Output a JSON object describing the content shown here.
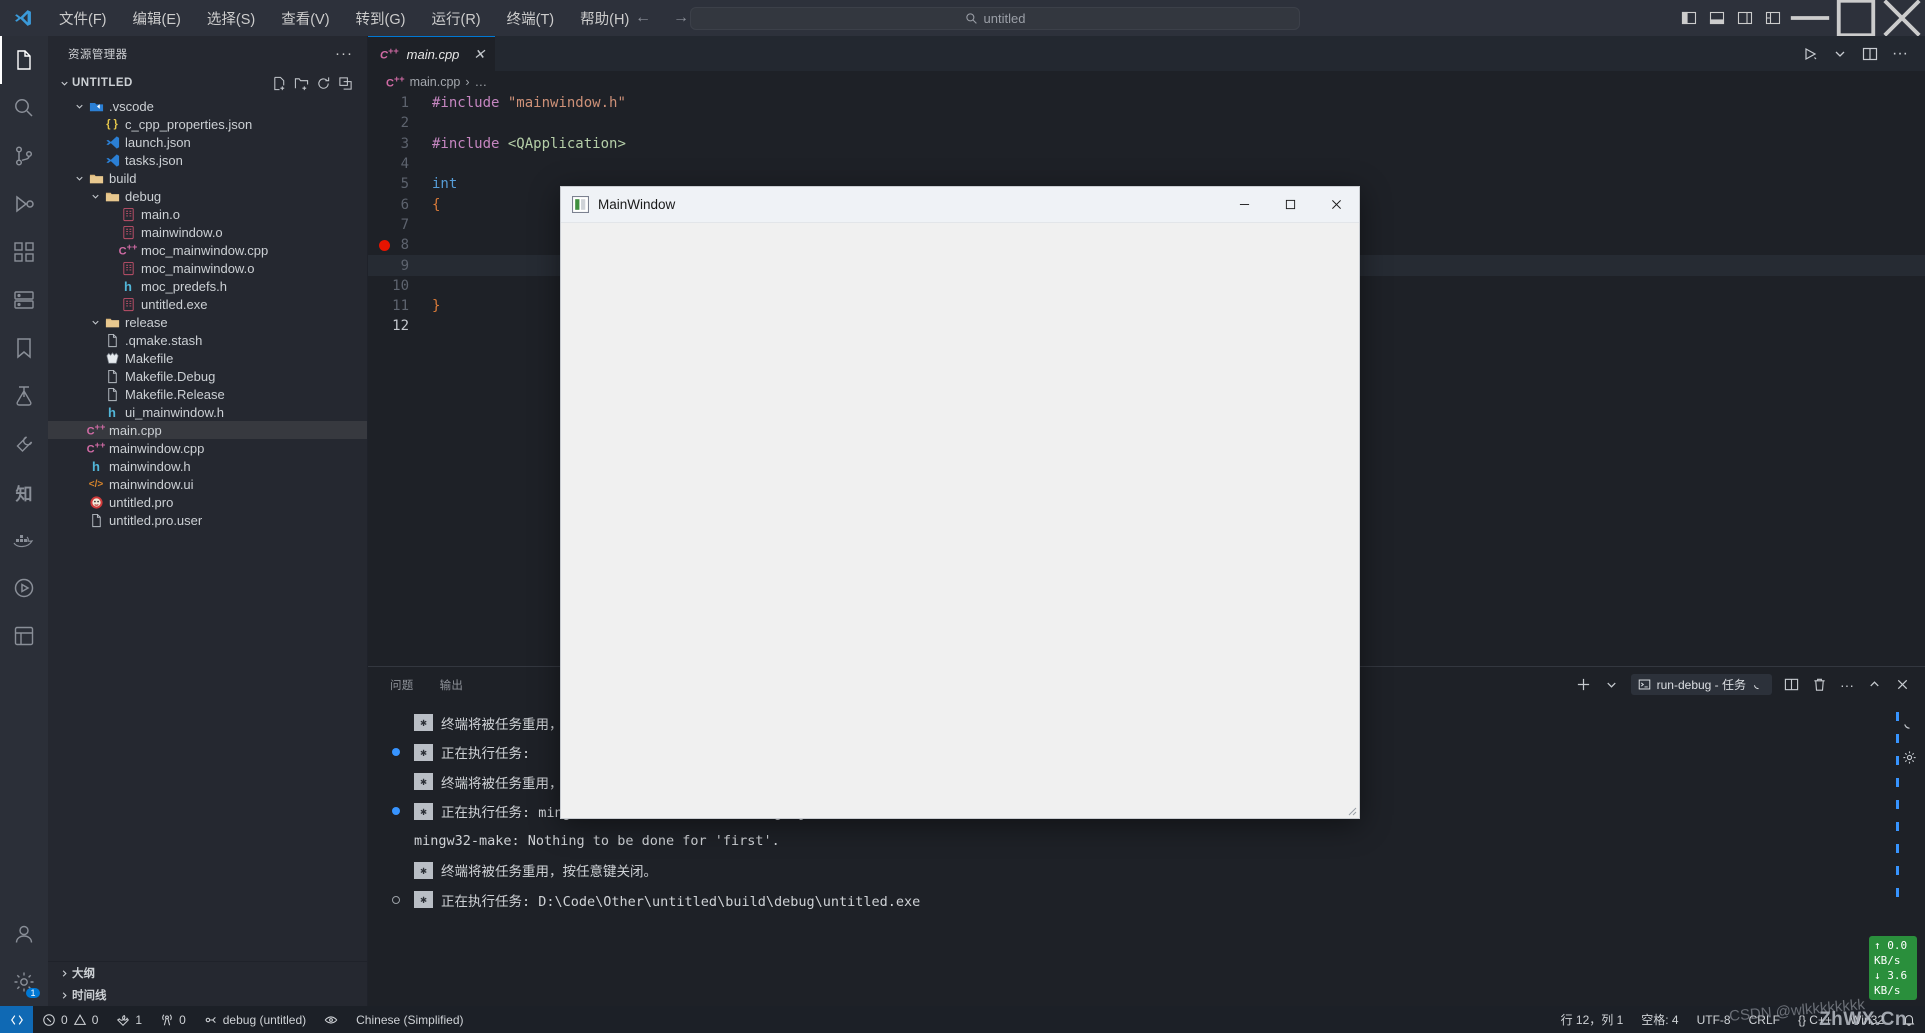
{
  "titlebar": {
    "menus": [
      "文件(F)",
      "编辑(E)",
      "选择(S)",
      "查看(V)",
      "转到(G)",
      "运行(R)",
      "终端(T)",
      "帮助(H)"
    ],
    "back_icon": "arrow-left-icon",
    "forward_icon": "arrow-right-icon",
    "search_text": "untitled",
    "search_icon": "search-icon",
    "layout_icons": [
      "toggle-primary-sidebar-icon",
      "toggle-panel-icon",
      "toggle-secondary-sidebar-icon",
      "customize-layout-icon"
    ],
    "window_controls": [
      "minimize",
      "maximize",
      "close"
    ]
  },
  "activitybar": {
    "items": [
      {
        "name": "explorer",
        "icon": "files-icon",
        "active": true,
        "badge": ""
      },
      {
        "name": "search",
        "icon": "search-icon",
        "active": false,
        "badge": ""
      },
      {
        "name": "source-control",
        "icon": "source-control-icon",
        "active": false,
        "badge": ""
      },
      {
        "name": "run-and-debug",
        "icon": "debug-icon",
        "active": false,
        "badge": ""
      },
      {
        "name": "extensions",
        "icon": "extensions-icon",
        "active": false,
        "badge": ""
      },
      {
        "name": "remote-explorer",
        "icon": "remote-explorer-icon",
        "active": false,
        "badge": ""
      },
      {
        "name": "bookmarks",
        "icon": "bookmark-icon",
        "active": false,
        "badge": ""
      },
      {
        "name": "test",
        "icon": "beaker-icon",
        "active": false,
        "badge": ""
      },
      {
        "name": "cmake",
        "icon": "tools-icon",
        "active": false,
        "badge": ""
      },
      {
        "name": "chinese",
        "icon": "zhi-icon",
        "active": false,
        "badge": ""
      },
      {
        "name": "docker",
        "icon": "docker-icon",
        "active": false,
        "badge": ""
      },
      {
        "name": "runner",
        "icon": "play-circle-icon",
        "active": false,
        "badge": ""
      },
      {
        "name": "project-manager",
        "icon": "project-icon",
        "active": false,
        "badge": ""
      }
    ],
    "bottom": [
      {
        "name": "accounts",
        "icon": "account-icon"
      },
      {
        "name": "settings",
        "icon": "gear-icon",
        "badge": "1"
      }
    ]
  },
  "sidebar": {
    "title": "资源管理器",
    "more_label": "···",
    "root_label": "UNTITLED",
    "root_actions": [
      "new-file-icon",
      "new-folder-icon",
      "refresh-icon",
      "collapse-all-icon"
    ],
    "tree": [
      {
        "label": ".vscode",
        "depth": 1,
        "type": "folder-vscode",
        "expanded": true,
        "selected": false
      },
      {
        "label": "c_cpp_properties.json",
        "depth": 2,
        "type": "json",
        "expanded": null,
        "selected": false
      },
      {
        "label": "launch.json",
        "depth": 2,
        "type": "vscode-json",
        "expanded": null,
        "selected": false
      },
      {
        "label": "tasks.json",
        "depth": 2,
        "type": "vscode-json",
        "expanded": null,
        "selected": false
      },
      {
        "label": "build",
        "depth": 1,
        "type": "folder",
        "expanded": true,
        "selected": false
      },
      {
        "label": "debug",
        "depth": 2,
        "type": "folder",
        "expanded": true,
        "selected": false
      },
      {
        "label": "main.o",
        "depth": 3,
        "type": "binary",
        "expanded": null,
        "selected": false
      },
      {
        "label": "mainwindow.o",
        "depth": 3,
        "type": "binary",
        "expanded": null,
        "selected": false
      },
      {
        "label": "moc_mainwindow.cpp",
        "depth": 3,
        "type": "cpp",
        "expanded": null,
        "selected": false
      },
      {
        "label": "moc_mainwindow.o",
        "depth": 3,
        "type": "binary",
        "expanded": null,
        "selected": false
      },
      {
        "label": "moc_predefs.h",
        "depth": 3,
        "type": "header",
        "expanded": null,
        "selected": false
      },
      {
        "label": "untitled.exe",
        "depth": 3,
        "type": "binary",
        "expanded": null,
        "selected": false
      },
      {
        "label": "release",
        "depth": 2,
        "type": "folder",
        "expanded": true,
        "selected": false
      },
      {
        "label": ".qmake.stash",
        "depth": 2,
        "type": "file",
        "expanded": null,
        "selected": false
      },
      {
        "label": "Makefile",
        "depth": 2,
        "type": "makefile",
        "expanded": null,
        "selected": false
      },
      {
        "label": "Makefile.Debug",
        "depth": 2,
        "type": "file",
        "expanded": null,
        "selected": false
      },
      {
        "label": "Makefile.Release",
        "depth": 2,
        "type": "file",
        "expanded": null,
        "selected": false
      },
      {
        "label": "ui_mainwindow.h",
        "depth": 2,
        "type": "header",
        "expanded": null,
        "selected": false
      },
      {
        "label": "main.cpp",
        "depth": 1,
        "type": "cpp",
        "expanded": null,
        "selected": true
      },
      {
        "label": "mainwindow.cpp",
        "depth": 1,
        "type": "cpp",
        "expanded": null,
        "selected": false
      },
      {
        "label": "mainwindow.h",
        "depth": 1,
        "type": "header",
        "expanded": null,
        "selected": false
      },
      {
        "label": "mainwindow.ui",
        "depth": 1,
        "type": "ui",
        "expanded": null,
        "selected": false
      },
      {
        "label": "untitled.pro",
        "depth": 1,
        "type": "qt",
        "expanded": null,
        "selected": false
      },
      {
        "label": "untitled.pro.user",
        "depth": 1,
        "type": "file",
        "expanded": null,
        "selected": false
      }
    ],
    "bottom_sections": [
      "大纲",
      "时间线"
    ]
  },
  "editor": {
    "tab": {
      "label": "main.cpp",
      "icon": "cpp-icon",
      "close_icon": "close-icon",
      "dirty": false
    },
    "actions": [
      "run-icon",
      "chevron-down-icon",
      "split-editor-icon",
      "more-actions-icon",
      "settings-gear-icon"
    ],
    "breadcrumb": [
      "main.cpp",
      "…"
    ],
    "breadcrumb_sep": "›",
    "lines": [
      {
        "no": "1",
        "bp": false,
        "tokens": [
          {
            "t": "#include",
            "c": "kw"
          },
          {
            "t": " ",
            "c": "punc"
          },
          {
            "t": "\"mainwindow.h\"",
            "c": "str"
          }
        ]
      },
      {
        "no": "2",
        "bp": false,
        "tokens": []
      },
      {
        "no": "3",
        "bp": false,
        "tokens": [
          {
            "t": "#include",
            "c": "kw"
          },
          {
            "t": " ",
            "c": "punc"
          },
          {
            "t": "<QApplication>",
            "c": "inc"
          }
        ]
      },
      {
        "no": "4",
        "bp": false,
        "tokens": []
      },
      {
        "no": "5",
        "bp": false,
        "tokens": [
          {
            "t": "int",
            "c": "kw2"
          },
          {
            "t": " ",
            "c": "punc"
          }
        ]
      },
      {
        "no": "6",
        "bp": false,
        "tokens": [
          {
            "t": "{",
            "c": "brc"
          }
        ]
      },
      {
        "no": "7",
        "bp": false,
        "tokens": []
      },
      {
        "no": "8",
        "bp": true,
        "tokens": []
      },
      {
        "no": "9",
        "bp": false,
        "tokens": []
      },
      {
        "no": "10",
        "bp": false,
        "tokens": []
      },
      {
        "no": "11",
        "bp": false,
        "tokens": [
          {
            "t": "}",
            "c": "brc"
          }
        ]
      },
      {
        "no": "12",
        "bp": false,
        "tokens": []
      }
    ]
  },
  "panel": {
    "tabs": [
      {
        "label": "问题",
        "active": false
      },
      {
        "label": "输出",
        "active": false
      }
    ],
    "add_icon": "plus-icon",
    "add_chevron": "chevron-down-icon",
    "terminal_chip": {
      "icon": "terminal-icon",
      "label": "run-debug - 任务",
      "spinner": "loading-spinner-icon"
    },
    "actions": [
      "split-terminal-icon",
      "kill-terminal-icon",
      "more-icon",
      "chevron-up-icon",
      "close-icon"
    ],
    "terminal_lines": [
      {
        "text": "终端将被任务重用，按任意键关闭。",
        "star": true,
        "dot": "none",
        "mono": false
      },
      {
        "text": "正在执行任务: ",
        "star": true,
        "dot": "filled",
        "mono": false
      },
      {
        "text": "终端将被任务重用，按任意键关闭。",
        "star": true,
        "dot": "none",
        "mono": false
      },
      {
        "text": "正在执行任务: mingw32-make -f Makefile.Debug -j7",
        "star": true,
        "dot": "filled",
        "mono": true
      },
      {
        "text": "mingw32-make: Nothing to be done for 'first'.",
        "star": false,
        "dot": "none",
        "mono": true
      },
      {
        "text": "终端将被任务重用，按任意键关闭。",
        "star": true,
        "dot": "none",
        "mono": false
      },
      {
        "text": "正在执行任务: D:\\Code\\Other\\untitled\\build\\debug\\untitled.exe",
        "star": true,
        "dot": "hollow",
        "mono": true
      }
    ],
    "right_icons": [
      "loading-icon",
      "gear-icon"
    ],
    "network": {
      "up": "↑ 0.0 KB/s",
      "down": "↓ 3.6 KB/s"
    }
  },
  "qt_window": {
    "title": "MainWindow",
    "icon": "qt-app-icon",
    "minimize_icon": "minimize-icon",
    "maximize_icon": "maximize-icon",
    "close_icon": "close-icon"
  },
  "statusbar": {
    "remote_icon": "remote-window-icon",
    "left": [
      {
        "icon": "error-icon",
        "label": "0",
        "icon2": "warning-icon",
        "label2": "0"
      },
      {
        "icon": "tools-icon",
        "label": "1"
      },
      {
        "icon": "radio-tower-icon",
        "label": "0"
      },
      {
        "icon": "debug-alt-icon",
        "label": "debug (untitled)"
      },
      {
        "icon": "eye-icon",
        "label": ""
      },
      {
        "icon": "",
        "label": "Chinese (Simplified)"
      }
    ],
    "right": [
      {
        "label": "行 12，列 1"
      },
      {
        "label": "空格: 4"
      },
      {
        "label": "UTF-8"
      },
      {
        "label": "CRLF"
      },
      {
        "label": "{} C++"
      },
      {
        "label": "Win32"
      },
      {
        "icon": "bell-icon",
        "label": ""
      }
    ],
    "watermark": "ZhWX.Cn",
    "watermark2": "CSDN @wlkkkkkkkk"
  },
  "colors": {
    "accent": "#0078d4",
    "breakpoint": "#e51400",
    "terminal_dot": "#3794ff",
    "network_badge": "#2a8f3c",
    "titlebar_bg": "#2d313b",
    "sidebar_bg": "#252830",
    "editor_bg": "#1e2127"
  }
}
